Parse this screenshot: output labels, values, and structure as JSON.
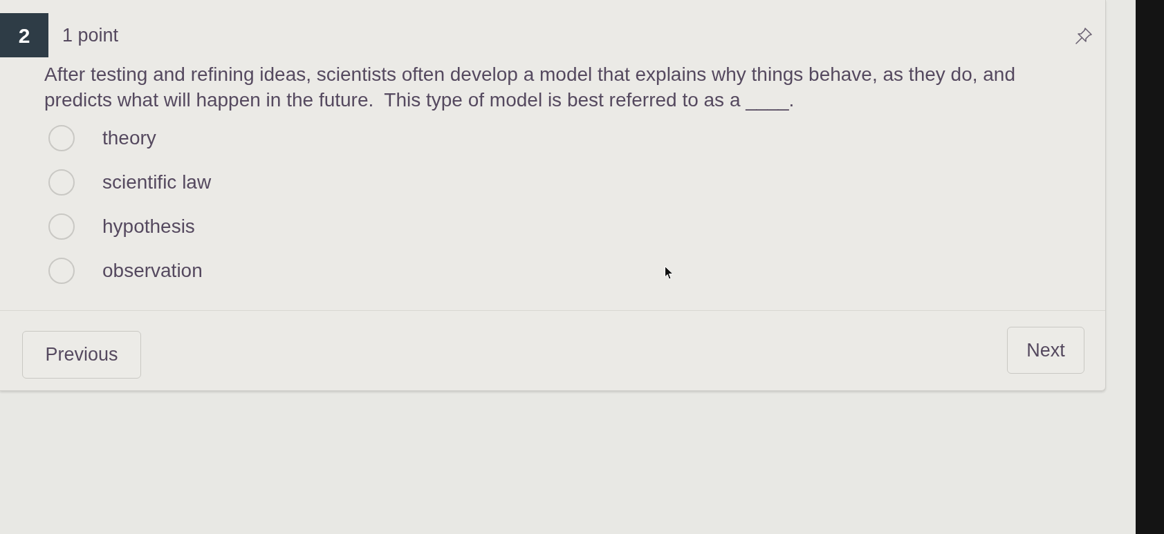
{
  "question": {
    "number": "2",
    "points": "1 point",
    "text": "After testing and refining ideas, scientists often develop a model that explains why things behave, as they do, and predicts what will happen in the future.  This type of model is best referred to as a ____."
  },
  "options": [
    {
      "label": "theory",
      "selected": false
    },
    {
      "label": "scientific law",
      "selected": false
    },
    {
      "label": "hypothesis",
      "selected": false
    },
    {
      "label": "observation",
      "selected": false
    }
  ],
  "navigation": {
    "previous": "Previous",
    "next": "Next"
  }
}
